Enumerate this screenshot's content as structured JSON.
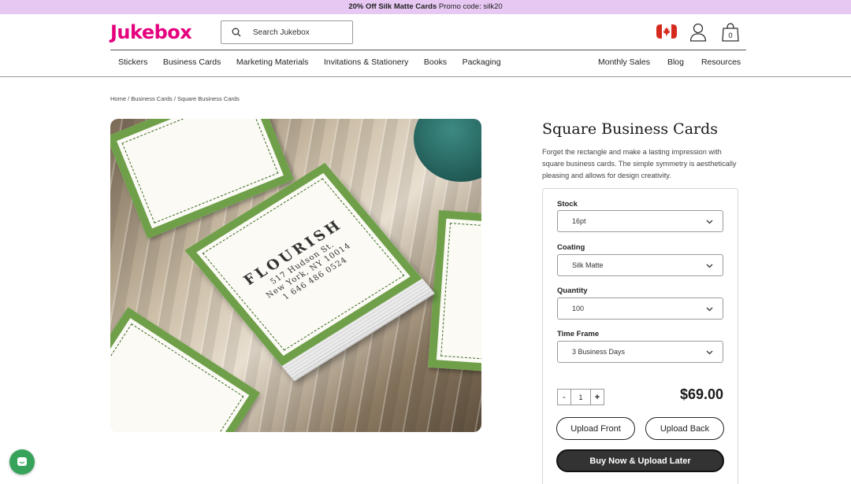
{
  "promo": {
    "bold": "20% Off Silk Matte Cards",
    "rest": " Promo code: silk20"
  },
  "header": {
    "logo": "Jukebox",
    "search_placeholder": "Search Jukebox",
    "icons": [
      "canada-flag-icon",
      "user-icon",
      "shopping-bag-icon"
    ]
  },
  "nav": {
    "left": [
      "Stickers",
      "Business Cards",
      "Marketing Materials",
      "Invitations & Stationery",
      "Books",
      "Packaging"
    ],
    "right": [
      "Monthly Sales",
      "Blog",
      "Resources"
    ]
  },
  "breadcrumb": "Home / Business Cards / Square Business Cards",
  "product": {
    "title": "Square Business Cards",
    "description": "Forget the rectangle and make a lasting impression with square business cards. The simple symmetry is aesthetically pleasing and allows for design creativity.",
    "image": {
      "card_text_1": "FLOURISH",
      "card_text_2": "517 Hudson St.",
      "card_text_3": "New York, NY 10014",
      "card_text_4": "1 646 486 0524"
    },
    "options": [
      {
        "label": "Stock",
        "value": "16pt"
      },
      {
        "label": "Coating",
        "value": "Silk Matte"
      },
      {
        "label": "Quantity",
        "value": "100"
      },
      {
        "label": "Time Frame",
        "value": "3 Business Days"
      }
    ],
    "quantity": {
      "minus": "-",
      "value": "1",
      "plus": "+"
    },
    "price": "$69.00",
    "buttons": {
      "upload_front": "Upload Front",
      "upload_back": "Upload Back",
      "buy_now": "Buy Now & Upload Later"
    }
  },
  "colors": {
    "brand": "#e5007e",
    "promo_bg": "#e6c8f2",
    "dark_button": "#333333",
    "chat": "#37a35a"
  }
}
